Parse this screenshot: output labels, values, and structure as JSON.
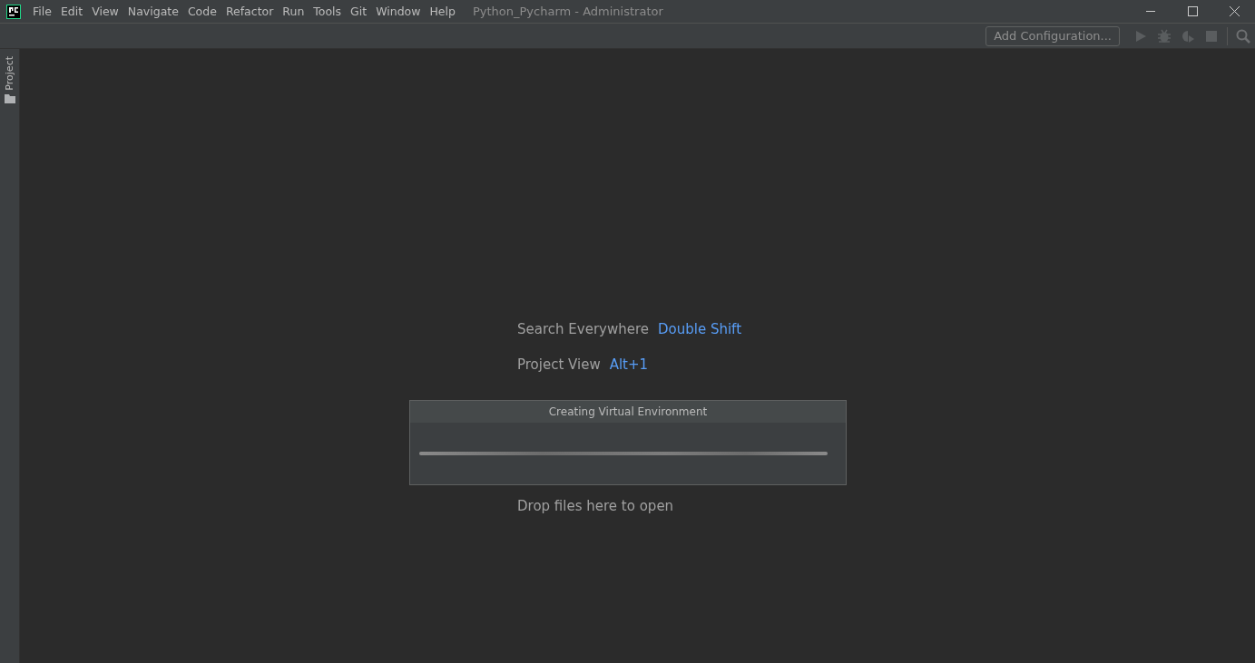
{
  "menu": [
    "File",
    "Edit",
    "View",
    "Navigate",
    "Code",
    "Refactor",
    "Run",
    "Tools",
    "Git",
    "Window",
    "Help"
  ],
  "window": {
    "title": "Python_Pycharm - Administrator"
  },
  "toolbar": {
    "configuration": "Add Configuration..."
  },
  "tool_stripe": {
    "label": "Project"
  },
  "hints": [
    {
      "action": "Search Everywhere",
      "shortcut": "Double Shift"
    },
    {
      "action": "Project View",
      "shortcut": "Alt+1"
    },
    {
      "action": "Drop files here to open"
    }
  ],
  "dialog": {
    "title": "Creating Virtual Environment",
    "progress": {
      "level": 1
    }
  }
}
